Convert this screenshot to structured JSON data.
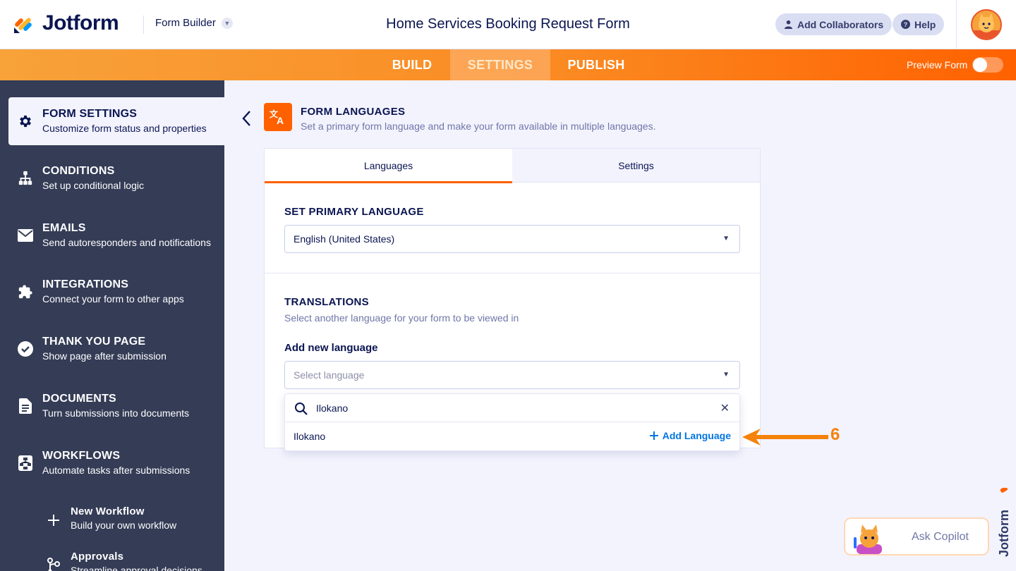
{
  "header": {
    "logo_text": "Jotform",
    "builder_label": "Form Builder",
    "form_title": "Home Services Booking Request Form",
    "add_collaborators": "Add Collaborators",
    "help": "Help"
  },
  "nav": {
    "tabs": [
      "BUILD",
      "SETTINGS",
      "PUBLISH"
    ],
    "active_tab": "SETTINGS",
    "preview_label": "Preview Form",
    "preview_on": false
  },
  "sidebar": {
    "items": [
      {
        "title": "FORM SETTINGS",
        "desc": "Customize form status and properties",
        "icon": "gear-icon"
      },
      {
        "title": "CONDITIONS",
        "desc": "Set up conditional logic",
        "icon": "conditions-icon"
      },
      {
        "title": "EMAILS",
        "desc": "Send autoresponders and notifications",
        "icon": "envelope-icon"
      },
      {
        "title": "INTEGRATIONS",
        "desc": "Connect your form to other apps",
        "icon": "puzzle-icon"
      },
      {
        "title": "THANK YOU PAGE",
        "desc": "Show page after submission",
        "icon": "check-circle-icon"
      },
      {
        "title": "DOCUMENTS",
        "desc": "Turn submissions into documents",
        "icon": "document-icon"
      },
      {
        "title": "WORKFLOWS",
        "desc": "Automate tasks after submissions",
        "icon": "workflow-icon"
      }
    ],
    "subitems": [
      {
        "title": "New Workflow",
        "desc": "Build your own workflow",
        "icon": "plus-icon"
      },
      {
        "title": "Approvals",
        "desc": "Streamline approval decisions",
        "icon": "approvals-icon"
      }
    ]
  },
  "section": {
    "title": "FORM LANGUAGES",
    "desc": "Set a primary form language and make your form available in multiple languages."
  },
  "card": {
    "tabs": [
      "Languages",
      "Settings"
    ],
    "primary_label": "SET PRIMARY LANGUAGE",
    "primary_value": "English (United States)",
    "translations_label": "TRANSLATIONS",
    "translations_desc": "Select another language for your form to be viewed in",
    "add_new_label": "Add new language",
    "select_placeholder": "Select language"
  },
  "dropdown": {
    "search_value": "Ilokano",
    "result": "Ilokano",
    "add_button": "Add Language"
  },
  "annotation": {
    "number": "6",
    "color": "#f5820b"
  },
  "copilot": {
    "label": "Ask Copilot"
  },
  "watermark": {
    "text": "Jotform"
  },
  "colors": {
    "accent": "#ff6100",
    "sidebar": "#343c56",
    "link": "#0075e3",
    "text": "#0a1551"
  }
}
